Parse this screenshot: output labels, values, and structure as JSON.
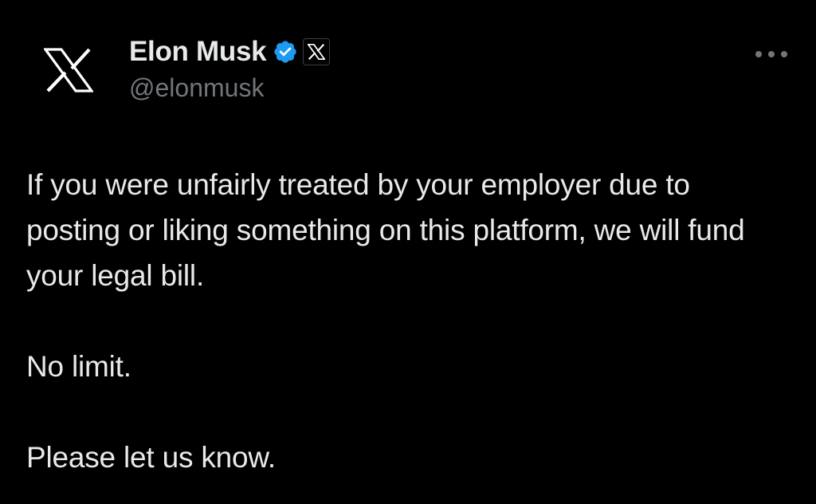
{
  "author": {
    "display_name": "Elon Musk",
    "handle": "@elonmusk",
    "avatar_icon": "x-logo-icon",
    "verified_icon": "verified-badge-icon",
    "affiliation_icon": "x-affiliate-badge-icon",
    "verified_color": "#1d9bf0"
  },
  "menu": {
    "icon": "more-options-icon"
  },
  "tweet": {
    "paragraphs": [
      "If you were unfairly treated by your employer due to posting or liking something on this platform, we will fund your legal bill.",
      "No limit.",
      "Please let us know."
    ]
  },
  "colors": {
    "background": "#000000",
    "text_primary": "#e7e9ea",
    "text_secondary": "#71767b"
  }
}
